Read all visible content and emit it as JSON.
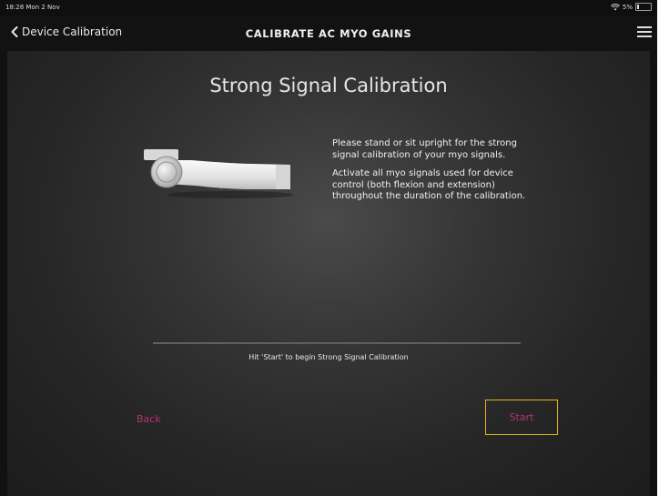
{
  "status_bar": {
    "time": "18:28  Mon 2 Nov",
    "battery": "5%"
  },
  "nav": {
    "back_label": "Device Calibration",
    "title": "CALIBRATE AC MYO GAINS",
    "menu_icon": "hamburger-menu-icon"
  },
  "main": {
    "heading": "Strong Signal Calibration",
    "instructions": [
      "Please stand or sit upright for the strong signal calibration of your myo signals.",
      "Activate all myo signals used for device control (both flexion and extension) throughout the duration of the calibration."
    ],
    "hint": "Hit 'Start' to begin Strong Signal Calibration",
    "back_label": "Back",
    "start_label": "Start"
  },
  "colors": {
    "accent_text": "#b5336e",
    "start_border": "#e3b512"
  }
}
